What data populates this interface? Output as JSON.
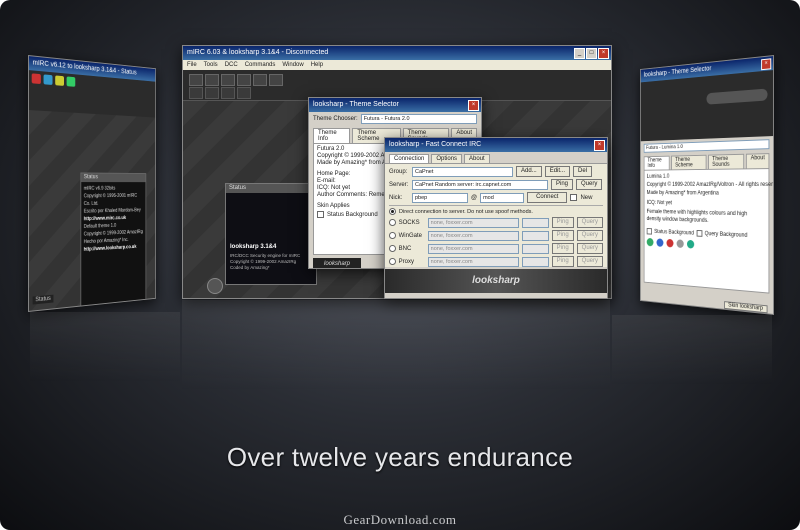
{
  "tagline": "Over twelve years endurance",
  "watermark": "GearDownload.com",
  "left_window": {
    "title": "mIRC v6.12 to looksharp 3.1&4 - Status",
    "status_title": "Status",
    "status_lines": [
      "mIRC v6.9 32bits",
      "Copyright © 1995-2001 mIRC Co. Ltd.",
      "Escrito por Khaled Mardam-Bey",
      "http://www.mirc.co.uk",
      "Default theme 1.0",
      "Copyright © 1999-2002 AmazIRg",
      "Hecho por Amazing* Inc.",
      "http://www.looksharp.co.uk"
    ],
    "bottom_label": "Status"
  },
  "center_window": {
    "title": "mIRC 6.03 & looksharp 3.1&4 - Disconnected",
    "menu": [
      "File",
      "Tools",
      "DCC",
      "Commands",
      "Window",
      "Help"
    ],
    "status_title": "Status",
    "status_brand": "looksharp 3.1&4",
    "status_lines": [
      "IRC/DCC Security engine for mIRC",
      "Copyright © 1999-2002 AmazIRg",
      "Coded by Amazing*"
    ]
  },
  "theme_selector": {
    "title": "looksharp - Theme Selector",
    "chooser_label": "Theme Chooser:",
    "chooser_value": "Futura - Futura 2.0",
    "tabs": [
      "Theme Info",
      "Theme Scheme",
      "Theme Sounds",
      "About"
    ],
    "info_lines": [
      "Futura 2.0",
      "Copyright © 1999-2002 AmazIRg/Voltron",
      "Made by Amazing* from Argentina"
    ],
    "home_label": "Home Page:",
    "email_label": "E-mail:",
    "icq_label": "ICQ:",
    "icq_value": "Not yet",
    "comments_label": "Author Comments:",
    "comments_value": "Remember Amazing*",
    "skin_label": "Skin Applies",
    "status_bg": "Status Background",
    "brand": "looksharp"
  },
  "fast_connect": {
    "title": "looksharp - Fast Connect IRC",
    "tabs": [
      "Connection",
      "Options",
      "About"
    ],
    "group_label": "Group:",
    "group_value": "CaPnet",
    "add": "Add...",
    "edit": "Edit...",
    "del": "Del",
    "server_label": "Server:",
    "server_value": "CaPnet Random server: irc.capnet.com",
    "ping": "Ping",
    "query": "Query",
    "nick_label": "Nick:",
    "nick_value": "pbep",
    "at": "@",
    "server_alias": "mod",
    "connect": "Connect",
    "new": "New",
    "direct": "Direct connection to server. Do not use spoof methods.",
    "proxies": [
      "SOCKS",
      "WinGate",
      "BNC",
      "Proxy"
    ],
    "proxy_placeholder": "none, foxxer.com",
    "banner": "looksharp"
  },
  "right_window": {
    "title": "looksharp - Theme Selector",
    "chooser_value": "Futura - Lumina 1.0",
    "tabs": [
      "Theme Info",
      "Theme Scheme",
      "Theme Sounds",
      "About"
    ],
    "info_lines": [
      "Lumina 1.0",
      "Copyright © 1999-2002 AmazIRg/Voltron - All rights reserved.",
      "Made by Amazing* from Argentina"
    ],
    "icq_value": "Not yet",
    "comments_value": "Female theme with highlights colours and high density window backgrounds.",
    "status_bg": "Status Background",
    "query_bg": "Query Background",
    "button": "Skin looksharp"
  }
}
